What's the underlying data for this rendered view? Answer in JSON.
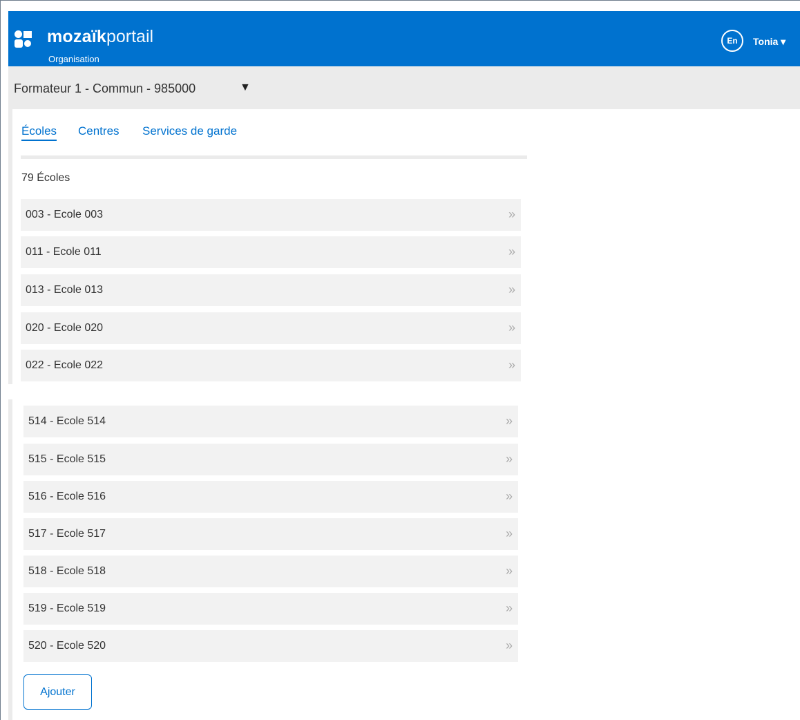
{
  "header": {
    "brand_bold": "mozaïk",
    "brand_light": "portail",
    "subtitle": "Organisation",
    "lang_label": "En",
    "user_label": "Tonia ▾",
    "color": "#0072cf"
  },
  "org_selector": {
    "label": "Formateur 1 - Commun - 985000",
    "caret": "▼"
  },
  "tabs": [
    {
      "label": "Écoles",
      "active": true
    },
    {
      "label": "Centres",
      "active": false
    },
    {
      "label": "Services de garde",
      "active": false
    }
  ],
  "schools": {
    "count_label": "79 Écoles",
    "top_items": [
      "003 - Ecole 003",
      "011 - Ecole 011",
      "013 - Ecole 013",
      "020 - Ecole 020",
      "022 - Ecole 022"
    ],
    "bottom_items": [
      "514 - Ecole 514",
      "515 - Ecole 515",
      "516 - Ecole 516",
      "517 - Ecole 517",
      "518 - Ecole 518",
      "519 - Ecole 519",
      "520 - Ecole 520"
    ],
    "chevron": "»"
  },
  "actions": {
    "add_label": "Ajouter"
  }
}
